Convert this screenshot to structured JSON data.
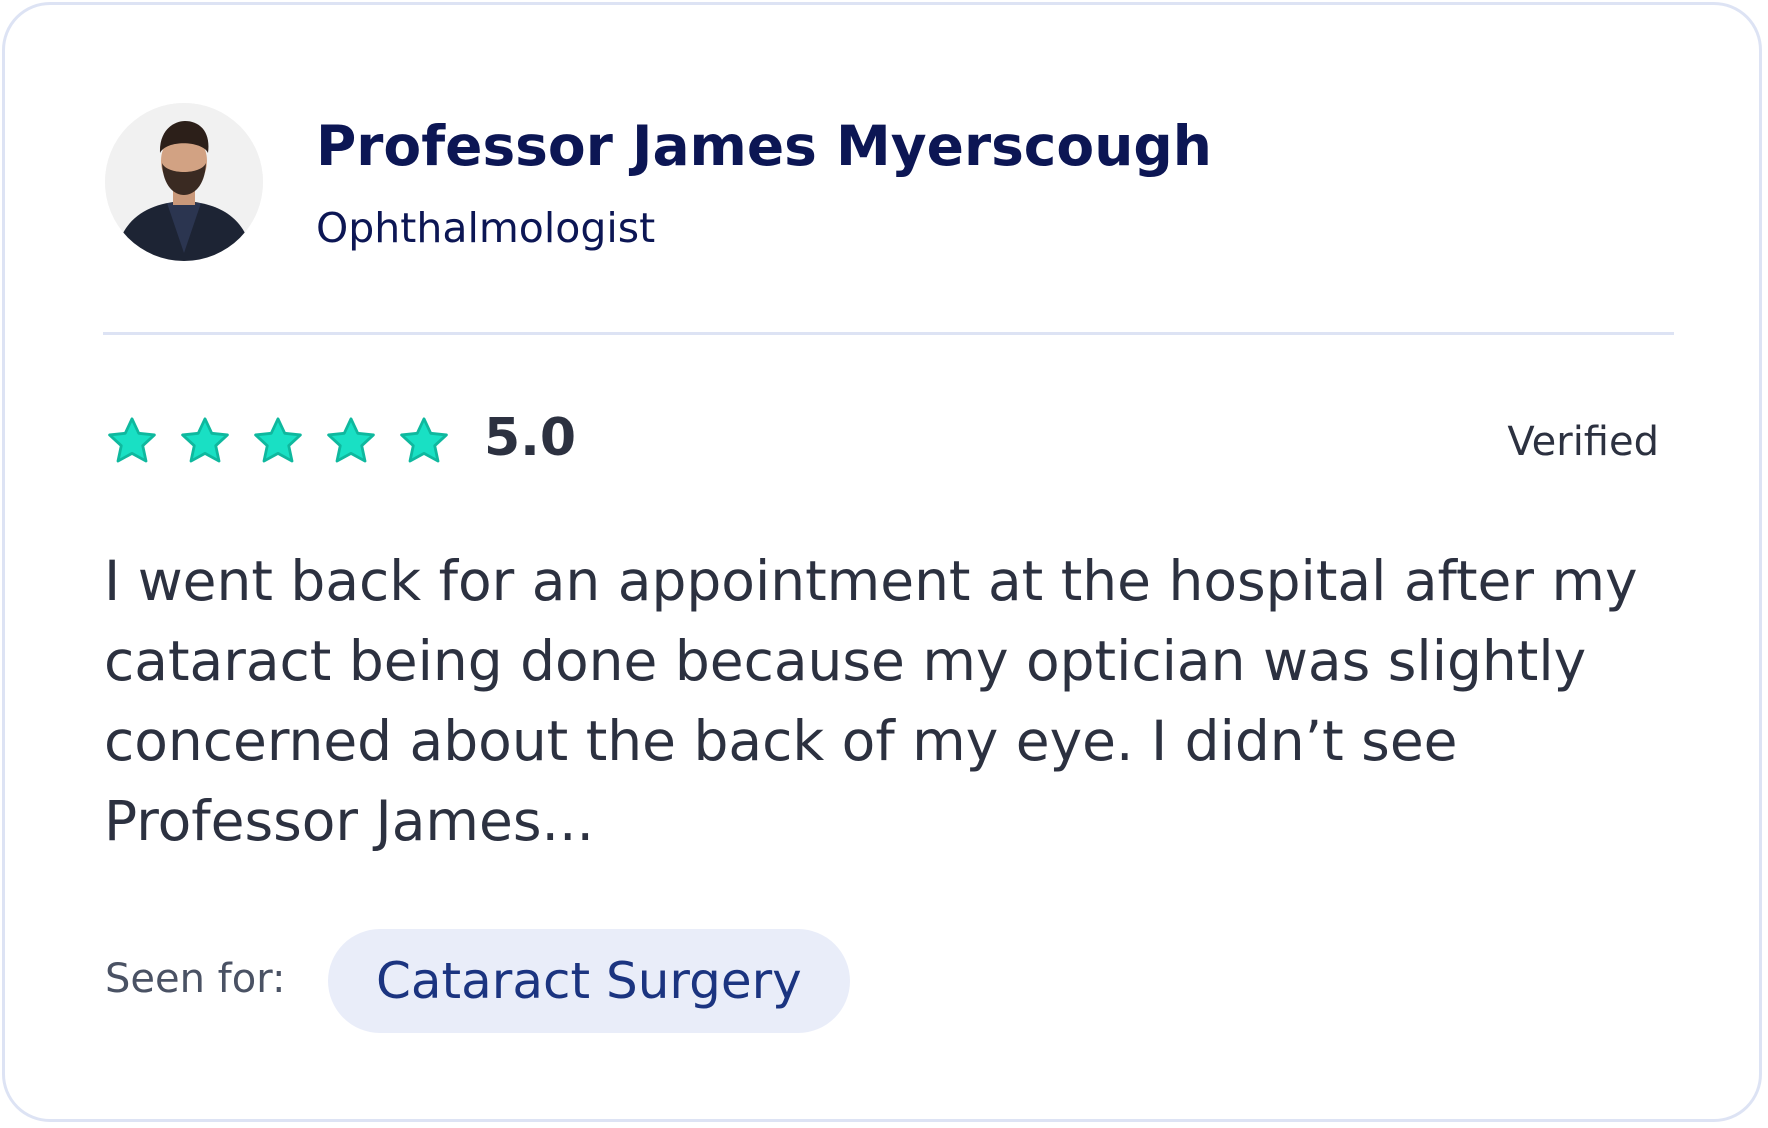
{
  "doctor": {
    "name": "Professor James Myerscough",
    "specialty": "Ophthalmologist",
    "avatar_icon": "doctor-portrait"
  },
  "rating": {
    "stars": 5,
    "max_stars": 5,
    "value": "5.0",
    "star_color": "#19e0c4",
    "verified_label": "Verified"
  },
  "review": {
    "text": "I went back for an appointment at the hospital after my cataract being done because my optician was slightly concerned about the back of my eye. I didn’t see Professor James..."
  },
  "seen_for": {
    "label": "Seen for:",
    "tag": "Cataract Surgery"
  },
  "colors": {
    "name": "#0c1654",
    "text": "#2c3140",
    "tag_bg": "#e9edf9",
    "tag_text": "#1b3480",
    "border": "#dde3f4"
  }
}
